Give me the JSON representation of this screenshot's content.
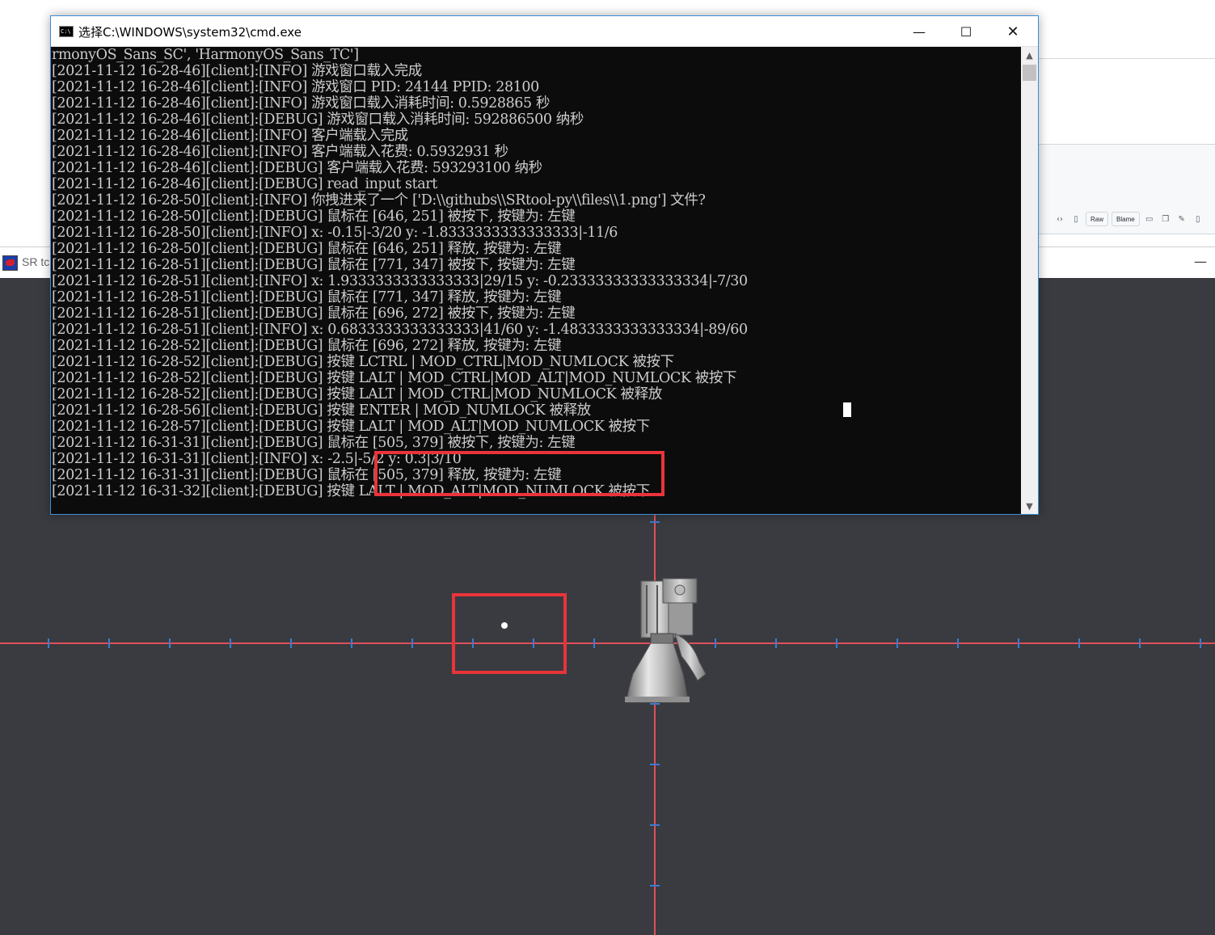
{
  "background_page": {
    "toolbar": [
      "Raw",
      "Blame"
    ],
    "icons": [
      "code-icon",
      "file-icon",
      "desktop-icon",
      "copy-icon",
      "pencil-icon",
      "trash-icon"
    ]
  },
  "sr_window": {
    "title": "SR tc",
    "minimize_glyph": "—"
  },
  "cmd_window": {
    "title": "选择C:\\WINDOWS\\system32\\cmd.exe",
    "icon_text": "C:\\",
    "minimize_glyph": "—",
    "maximize_glyph": "☐",
    "close_glyph": "✕",
    "lines": [
      "rmonyOS_Sans_SC', 'HarmonyOS_Sans_TC']",
      "[2021-11-12 16-28-46][client]:[INFO] 游戏窗口载入完成",
      "[2021-11-12 16-28-46][client]:[INFO] 游戏窗口 PID: 24144 PPID: 28100",
      "[2021-11-12 16-28-46][client]:[INFO] 游戏窗口载入消耗时间: 0.5928865 秒",
      "[2021-11-12 16-28-46][client]:[DEBUG] 游戏窗口载入消耗时间: 592886500 纳秒",
      "[2021-11-12 16-28-46][client]:[INFO] 客户端载入完成",
      "[2021-11-12 16-28-46][client]:[INFO] 客户端载入花费: 0.5932931 秒",
      "[2021-11-12 16-28-46][client]:[DEBUG] 客户端载入花费: 593293100 纳秒",
      "[2021-11-12 16-28-46][client]:[DEBUG] read_input start",
      "[2021-11-12 16-28-50][client]:[INFO] 你拽进来了一个 ['D:\\\\githubs\\\\SRtool-py\\\\files\\\\1.png'] 文件?",
      "[2021-11-12 16-28-50][client]:[DEBUG] 鼠标在 [646, 251] 被按下, 按键为: 左键",
      "[2021-11-12 16-28-50][client]:[INFO] x: -0.15|-3/20 y: -1.8333333333333333|-11/6",
      "[2021-11-12 16-28-50][client]:[DEBUG] 鼠标在 [646, 251] 释放, 按键为: 左键",
      "[2021-11-12 16-28-51][client]:[DEBUG] 鼠标在 [771, 347] 被按下, 按键为: 左键",
      "[2021-11-12 16-28-51][client]:[INFO] x: 1.9333333333333333|29/15 y: -0.23333333333333334|-7/30",
      "[2021-11-12 16-28-51][client]:[DEBUG] 鼠标在 [771, 347] 释放, 按键为: 左键",
      "[2021-11-12 16-28-51][client]:[DEBUG] 鼠标在 [696, 272] 被按下, 按键为: 左键",
      "[2021-11-12 16-28-51][client]:[INFO] x: 0.6833333333333333|41/60 y: -1.4833333333333334|-89/60",
      "[2021-11-12 16-28-52][client]:[DEBUG] 鼠标在 [696, 272] 释放, 按键为: 左键",
      "[2021-11-12 16-28-52][client]:[DEBUG] 按键 LCTRL | MOD_CTRL|MOD_NUMLOCK 被按下",
      "[2021-11-12 16-28-52][client]:[DEBUG] 按键 LALT | MOD_CTRL|MOD_ALT|MOD_NUMLOCK 被按下",
      "[2021-11-12 16-28-52][client]:[DEBUG] 按键 LALT | MOD_CTRL|MOD_NUMLOCK 被释放",
      "[2021-11-12 16-28-56][client]:[DEBUG] 按键 ENTER | MOD_NUMLOCK 被释放",
      "[2021-11-12 16-28-57][client]:[DEBUG] 按键 LALT | MOD_ALT|MOD_NUMLOCK 被按下",
      "[2021-11-12 16-31-31][client]:[DEBUG] 鼠标在 [505, 379] 被按下, 按键为: 左键",
      "[2021-11-12 16-31-31][client]:[INFO] x: -2.5|-5/2 y: 0.3|3/10",
      "[2021-11-12 16-31-31][client]:[DEBUG] 鼠标在 [505, 379] 释放, 按键为: 左键",
      "[2021-11-12 16-31-32][client]:[DEBUG] 按键 LALT | MOD_ALT|MOD_NUMLOCK 被按下"
    ]
  },
  "colors": {
    "console_bg": "#0c0c0c",
    "console_text": "#cccccc",
    "canvas_bg": "#393b40",
    "axis_red": "#e0505a",
    "tick_blue": "#3a7bd5",
    "highlight": "#e8343a"
  }
}
